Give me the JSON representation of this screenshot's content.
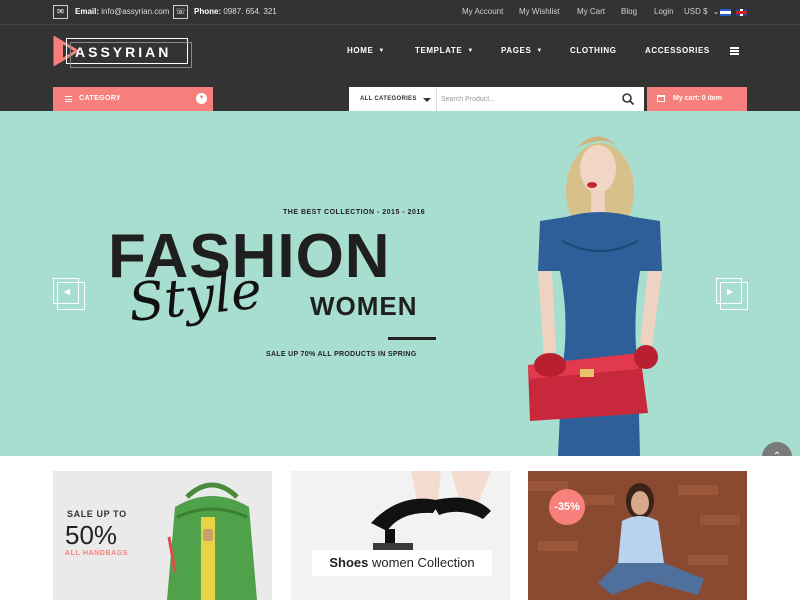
{
  "topbar": {
    "email_label": "Email:",
    "email_value": "info@assyrian.com",
    "phone_label": "Phone:",
    "phone_value": "0987. 654. 321",
    "links": [
      "My Account",
      "My Wishlist",
      "My Cart",
      "Blog",
      "Login"
    ],
    "currency": "USD $",
    "currency_caret": "⌄"
  },
  "brand": {
    "name": "ASSYRIAN",
    "accent_color": "#f7807c"
  },
  "nav": {
    "items": [
      "HOME",
      "TEMPLATE",
      "PAGES",
      "CLOTHING",
      "ACCESSORIES"
    ],
    "dropdown_flags": [
      true,
      true,
      true,
      false,
      false
    ]
  },
  "category": {
    "label": "CATEGORY",
    "icon": "chevron-down-icon"
  },
  "search": {
    "category_label": "ALL CATEGORIES",
    "placeholder": "Search Product..."
  },
  "cart": {
    "label": "My cart: 0 item"
  },
  "hero": {
    "kicker": "THE BEST COLLECTION - 2015 - 2016",
    "title": "FASHION",
    "script": "Style",
    "subtitle": "WOMEN",
    "tagline": "SALE UP 70% ALL PRODUCTS IN SPRING",
    "background_color": "#a8ded0"
  },
  "banners": {
    "handbags": {
      "sale_text": "SALE UP TO",
      "percent": "50%",
      "sub": "ALL HANDBAGS"
    },
    "shoes": {
      "bold": "Shoes",
      "rest": " women Collection"
    },
    "jeans": {
      "badge": "-35%"
    }
  },
  "icons": {
    "email": "email-icon",
    "phone": "phone-icon",
    "scroll_top": "chevron-up-icon",
    "prev": "chevron-left-icon",
    "next": "chevron-right-icon"
  }
}
